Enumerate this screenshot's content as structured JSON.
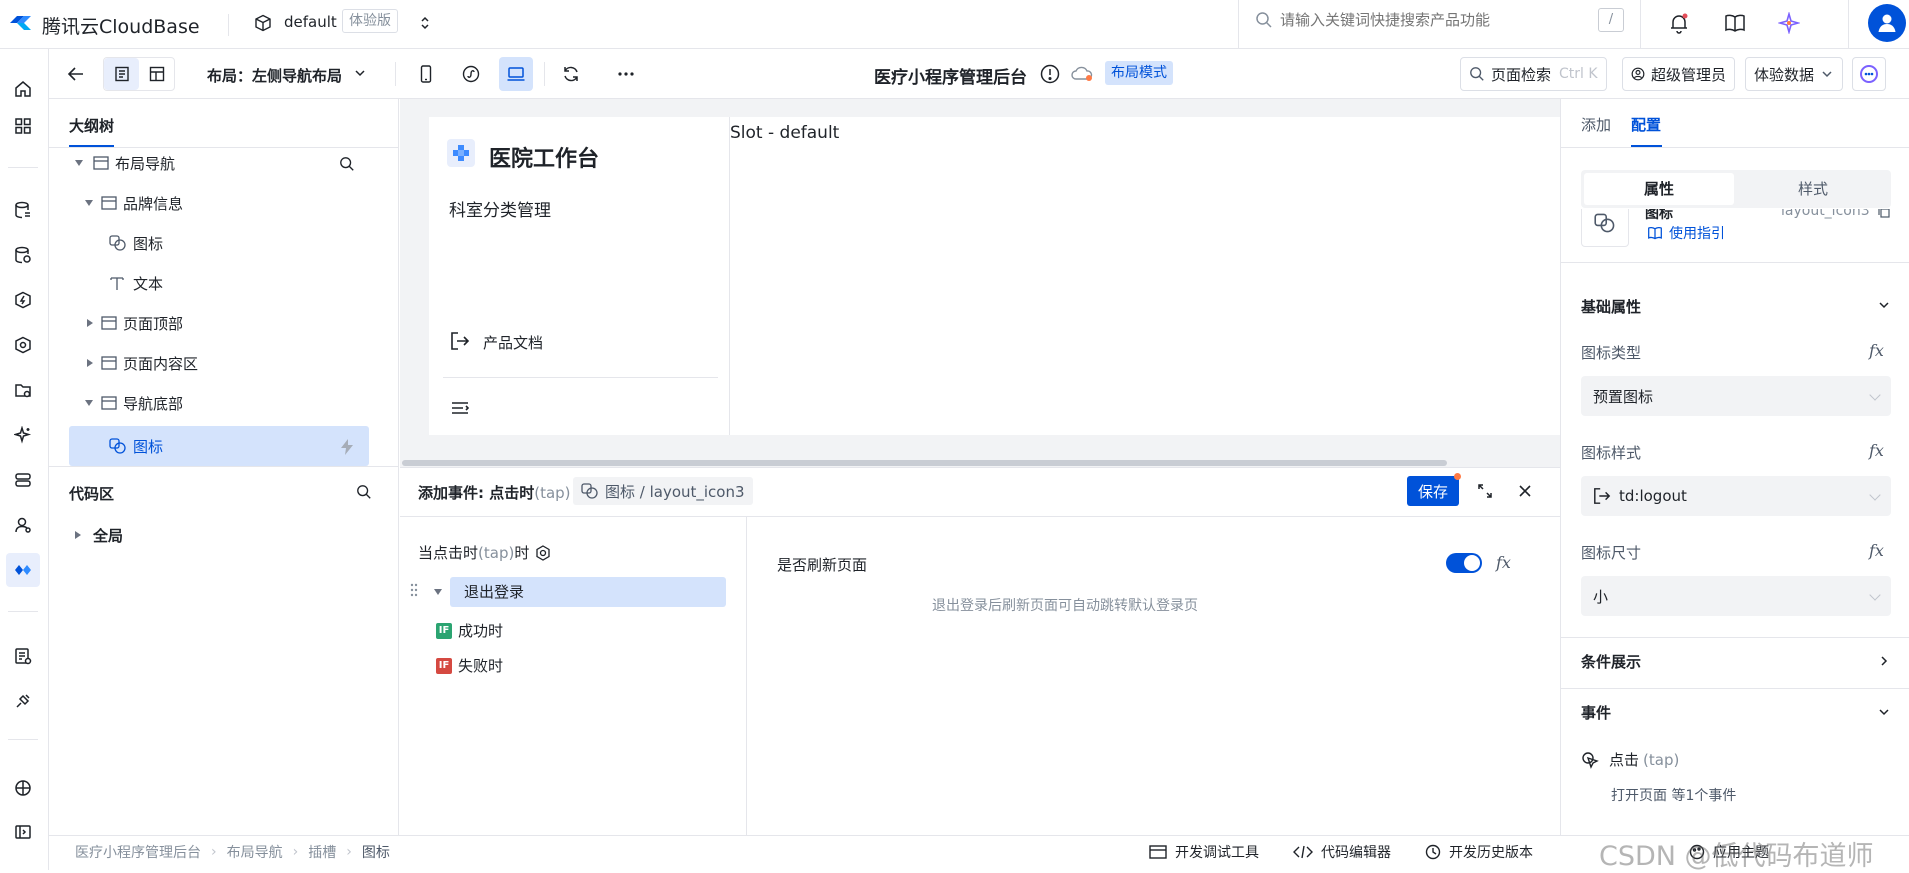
{
  "topbar": {
    "brand": "腾讯云CloudBase",
    "env_name": "default",
    "env_badge": "体验版",
    "search_placeholder": "请输入关键词快捷搜索产品功能",
    "search_shortcut": "/"
  },
  "toolbar": {
    "layout_label": "布局：",
    "layout_value": "左侧导航布局",
    "app_title": "医疗小程序管理后台",
    "mode_badge": "布局模式",
    "page_search_label": "页面检索",
    "page_search_shortcut": "Ctrl K",
    "admin_label": "超级管理员",
    "data_label": "体验数据"
  },
  "outline": {
    "tab_label": "大纲树",
    "items": [
      {
        "label": "布局导航"
      },
      {
        "label": "品牌信息"
      },
      {
        "label": "图标"
      },
      {
        "label": "文本"
      },
      {
        "label": "页面顶部"
      },
      {
        "label": "页面内容区"
      },
      {
        "label": "导航底部"
      },
      {
        "label": "图标"
      }
    ],
    "code_area_label": "代码区",
    "code_items": [
      {
        "label": "全局"
      }
    ]
  },
  "canvas": {
    "sidebar_title": "医院工作台",
    "menu_item": "科室分类管理",
    "doc_link": "产品文档",
    "slot_label": "Slot - default"
  },
  "event_panel": {
    "title": "添加事件: 点击时",
    "title_tap": "(tap)",
    "component_path": "图标 / layout_icon3",
    "save_label": "保存",
    "trigger_label": "当点击时",
    "trigger_tap": "(tap)",
    "trigger_suffix": "时",
    "action_label": "退出登录",
    "success_label": "成功时",
    "fail_label": "失败时",
    "if_tag": "IF",
    "refresh_label": "是否刷新页面",
    "refresh_hint": "退出登录后刷新页面可自动跳转默认登录页",
    "refresh_on": true
  },
  "right_panel": {
    "tabs": [
      {
        "label": "添加"
      },
      {
        "label": "配置"
      }
    ],
    "subtabs": [
      {
        "label": "属性"
      },
      {
        "label": "样式"
      }
    ],
    "component_name": "图标",
    "component_id": "layout_icon3",
    "usage_link": "使用指引",
    "basic_section": "基础属性",
    "icon_type_label": "图标类型",
    "icon_type_value": "预置图标",
    "icon_style_label": "图标样式",
    "icon_style_value": "td:logout",
    "icon_size_label": "图标尺寸",
    "icon_size_value": "小",
    "condition_section": "条件展示",
    "event_section": "事件",
    "event_name": "点击",
    "event_tap": "(tap)",
    "event_summary": "打开页面 等1个事件"
  },
  "footer": {
    "breadcrumb": [
      "医疗小程序管理后台",
      "布局导航",
      "插槽",
      "图标"
    ],
    "dev_tools": "开发调试工具",
    "code_editor": "代码编辑器",
    "history": "开发历史版本",
    "theme": "应用主题",
    "watermark": "CSDN @低代码布道师"
  },
  "colors": {
    "accent": "#0052d9",
    "selected_bg": "#d4e3fc",
    "if_success": "#2ba471",
    "if_fail": "#d54941"
  }
}
